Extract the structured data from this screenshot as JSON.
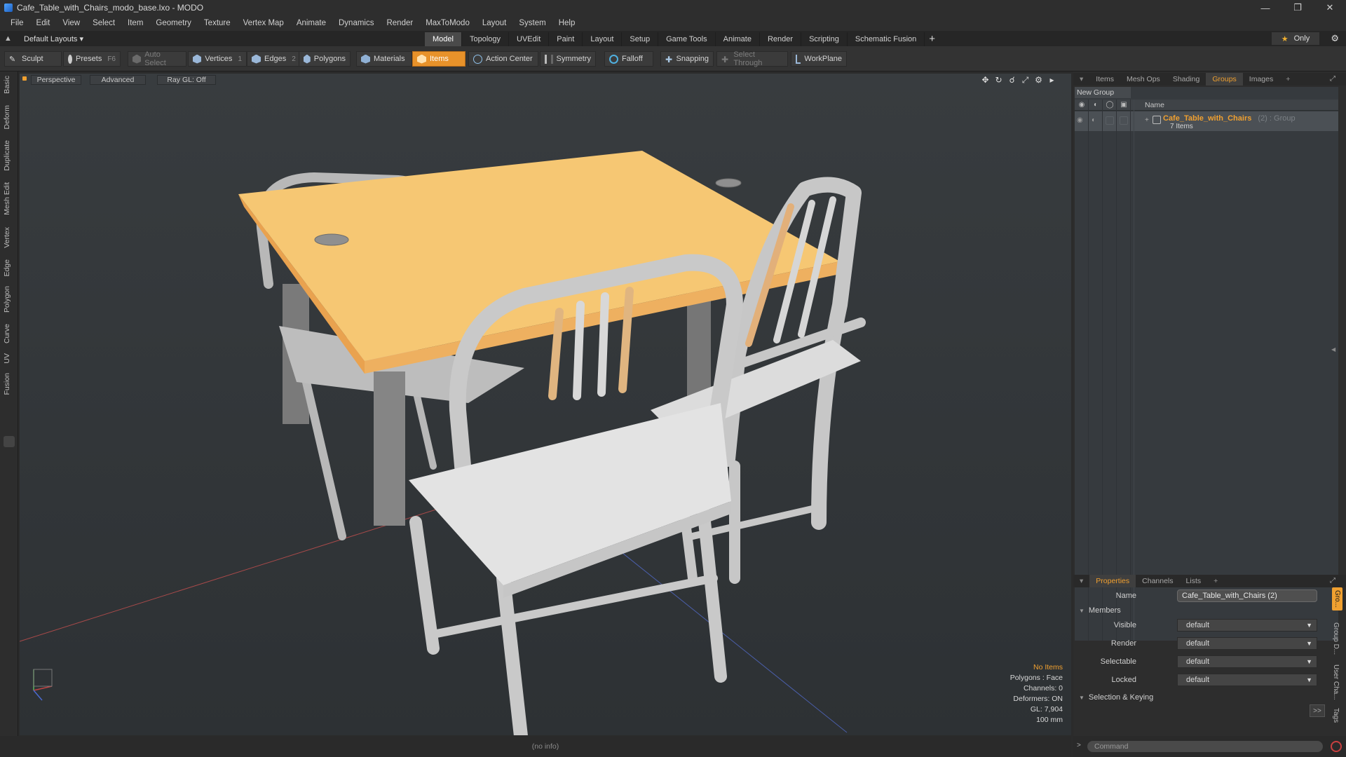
{
  "window": {
    "title": "Cafe_Table_with_Chairs_modo_base.lxo - MODO",
    "controls": [
      "—",
      "❐",
      "✕"
    ]
  },
  "menu": [
    "File",
    "Edit",
    "View",
    "Select",
    "Item",
    "Geometry",
    "Texture",
    "Vertex Map",
    "Animate",
    "Dynamics",
    "Render",
    "MaxToModo",
    "Layout",
    "System",
    "Help"
  ],
  "layoutbar": {
    "layout_name": "Default Layouts ▾",
    "tabs": [
      "Model",
      "Topology",
      "UVEdit",
      "Paint",
      "Layout",
      "Setup",
      "Game Tools",
      "Animate",
      "Render",
      "Scripting",
      "Schematic Fusion"
    ],
    "active_tab": "Model",
    "plus": "+",
    "only_label": "Only"
  },
  "toolbar": {
    "sculpt": "Sculpt",
    "presets": "Presets",
    "presets_key": "F6",
    "auto_select": "Auto Select",
    "vertices": "Vertices",
    "vertices_key": "1",
    "edges": "Edges",
    "edges_key": "2",
    "polygons": "Polygons",
    "materials": "Materials",
    "items": "Items",
    "action_center": "Action Center",
    "symmetry": "Symmetry",
    "falloff": "Falloff",
    "snapping": "Snapping",
    "select_through": "Select Through",
    "workplane": "WorkPlane"
  },
  "left_tabs": [
    "Basic",
    "Deform",
    "Duplicate",
    "Mesh Edit",
    "Vertex",
    "Edge",
    "Polygon",
    "Curve",
    "UV",
    "Fusion"
  ],
  "viewport": {
    "view": "Perspective",
    "shading": "Advanced",
    "raygl": "Ray GL: Off",
    "info": {
      "selection": "No Items",
      "polygons": "Polygons : Face",
      "channels": "Channels: 0",
      "deformers": "Deformers: ON",
      "gl": "GL: 7,904",
      "unit": "100 mm"
    }
  },
  "groups_panel": {
    "tabs": [
      "Items",
      "Mesh Ops",
      "Shading",
      "Groups",
      "Images"
    ],
    "active_tab": "Groups",
    "new_group": "New Group",
    "column_name": "Name",
    "group_name": "Cafe_Table_with_Chairs",
    "group_count": "(2) : Group",
    "group_items": "7 Items"
  },
  "properties_panel": {
    "tabs": [
      "Properties",
      "Channels",
      "Lists"
    ],
    "active_tab": "Properties",
    "name_label": "Name",
    "name_value": "Cafe_Table_with_Chairs (2)",
    "members_section": "Members",
    "rows": [
      {
        "label": "Visible",
        "value": "default"
      },
      {
        "label": "Render",
        "value": "default"
      },
      {
        "label": "Selectable",
        "value": "default"
      },
      {
        "label": "Locked",
        "value": "default"
      }
    ],
    "selection_section": "Selection & Keying",
    "side_tabs": [
      "Gro...",
      "Group D...",
      "User Cha...",
      "Tags"
    ],
    "expand": ">>"
  },
  "status": {
    "info": "(no info)"
  },
  "command": {
    "placeholder": "Command"
  },
  "colors": {
    "accent": "#f0a030",
    "table_top": "#f6c773",
    "chair": "#d9d9d9"
  }
}
